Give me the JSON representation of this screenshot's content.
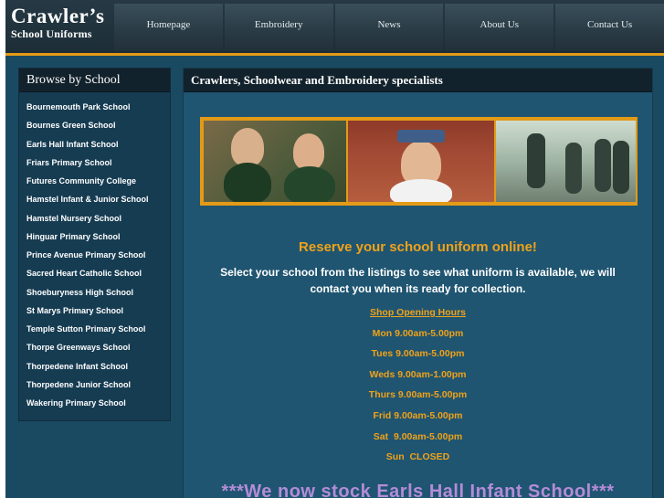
{
  "logo": {
    "main": "Crawler’s",
    "sub": "School Uniforms"
  },
  "nav": [
    "Homepage",
    "Embroidery",
    "News",
    "About Us",
    "Contact Us"
  ],
  "sidebar": {
    "title": "Browse by School",
    "schools": [
      "Bournemouth Park School",
      "Bournes Green School",
      "Earls Hall Infant School",
      "Friars Primary School",
      "Futures Community College",
      "Hamstel Infant & Junior School",
      "Hamstel Nursery School",
      "Hinguar Primary School",
      "Prince Avenue Primary School",
      "Sacred Heart Catholic School",
      "Shoeburyness High School",
      "St Marys Primary School",
      "Temple Sutton Primary School",
      "Thorpe Greenways School",
      "Thorpedene Infant School",
      "Thorpedene Junior School",
      "Wakering Primary School"
    ]
  },
  "main": {
    "title": "Crawlers, Schoolwear and Embroidery specialists",
    "reserve": "Reserve your school uniform online!",
    "select_text": "Select your school from the listings to see what uniform is available, we will contact you when its ready for collection.",
    "hours_title": "Shop Opening Hours",
    "hours": [
      "Mon 9.00am-5.00pm",
      "Tues 9.00am-5.00pm",
      "Weds 9.00am-1.00pm",
      "Thurs 9.00am-5.00pm",
      "Frid 9.00am-5.00pm",
      "Sat  9.00am-5.00pm",
      "Sun  CLOSED"
    ],
    "stock": "***We now stock Earls Hall Infant School***"
  },
  "colors": {
    "accent": "#e39a17",
    "background": "#1a4a61",
    "highlight_text": "#f0a21a",
    "stock_text": "#b48cd8"
  }
}
